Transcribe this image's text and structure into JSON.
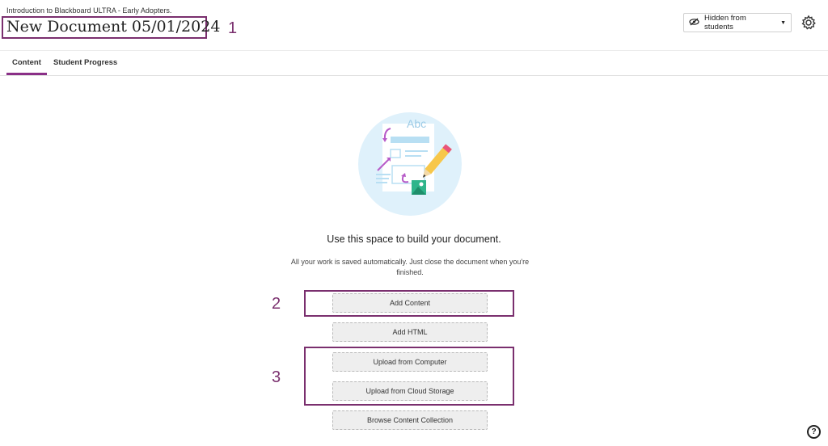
{
  "header": {
    "breadcrumb": "Introduction to Blackboard ULTRA - Early Adopters.",
    "title": "New Document 05/01/2024",
    "visibility_label": "Hidden from students"
  },
  "tabs": [
    {
      "label": "Content"
    },
    {
      "label": "Student Progress"
    }
  ],
  "illustration": {
    "text": "Abc"
  },
  "main": {
    "heading": "Use this space to build your document.",
    "subtext": "All your work is saved automatically. Just close the document when you're finished.",
    "buttons": [
      {
        "label": "Add Content"
      },
      {
        "label": "Add HTML"
      },
      {
        "label": "Upload from Computer"
      },
      {
        "label": "Upload from Cloud Storage"
      },
      {
        "label": "Browse Content Collection"
      }
    ]
  },
  "callouts": [
    "1",
    "2",
    "3"
  ],
  "help": {
    "symbol": "?"
  },
  "colors": {
    "accent": "#8a2f87",
    "callout": "#7a2f6e",
    "button_bg": "#eeeeee"
  }
}
